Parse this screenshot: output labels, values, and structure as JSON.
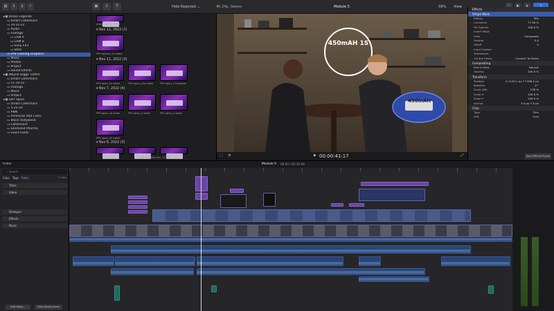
{
  "toolbar": {
    "hide_rejected": "Hide Rejected",
    "format": "4K 24p, Stereo",
    "project": "Module 5",
    "zoom": "59%",
    "view": "View",
    "inspector_title": "Effects",
    "tab_clip": "Clip"
  },
  "library": {
    "items": [
      {
        "label": "Drone Legends",
        "indent": 1
      },
      {
        "label": "Smart Collections",
        "indent": 2
      },
      {
        "label": "10-31-22",
        "indent": 2
      },
      {
        "label": "Audio",
        "indent": 2
      },
      {
        "label": "Footage",
        "indent": 2
      },
      {
        "label": "CAM A",
        "indent": 3
      },
      {
        "label": "CAM B",
        "indent": 3
      },
      {
        "label": "Sony FX3",
        "indent": 3
      },
      {
        "label": "Stills",
        "indent": 3
      },
      {
        "label": "FPV Gaming Graphics",
        "indent": 2,
        "selected": true
      },
      {
        "label": "Music",
        "indent": 2
      },
      {
        "label": "Photos",
        "indent": 2
      },
      {
        "label": "Project",
        "indent": 2
      },
      {
        "label": "Sound Effects",
        "indent": 2
      },
      {
        "label": "Wayne Diggs' Father",
        "indent": 1
      },
      {
        "label": "Smart Collections",
        "indent": 2
      },
      {
        "label": "11-10-22",
        "indent": 2
      },
      {
        "label": "Footage",
        "indent": 2
      },
      {
        "label": "Music",
        "indent": 2
      },
      {
        "label": "Project",
        "indent": 2
      },
      {
        "label": "Self Tapes",
        "indent": 1
      },
      {
        "label": "Smart Collections",
        "indent": 2
      },
      {
        "label": "5-25-20",
        "indent": 2
      },
      {
        "label": "ANN",
        "indent": 2
      },
      {
        "label": "American Red Cross",
        "indent": 2
      },
      {
        "label": "Black Hollywood",
        "indent": 2
      },
      {
        "label": "Catamount",
        "indent": 2
      },
      {
        "label": "Desmond Pharma",
        "indent": 2
      },
      {
        "label": "Giant Foods",
        "indent": 2
      }
    ]
  },
  "browser": {
    "groups": [
      {
        "date": "Nov 12, 2022",
        "count": "(1)",
        "thumbs": [
          "FPV opener_v3 video"
        ]
      },
      {
        "date": "Nov 11, 2022",
        "count": "(3)",
        "thumbs": [
          "FPV open_1a video",
          "FPV open_v2a video",
          "FPV open_1 thoughts"
        ]
      },
      {
        "date": "Nov 7, 2022",
        "count": "(4)",
        "thumbs": [
          "FPV open_1b video",
          "FPV open_2 video",
          "FPV open_2 video"
        ]
      },
      {
        "date": "Nov 6, 2022",
        "count": "(3)",
        "thumbs": [
          "FPV open_v1 video"
        ]
      }
    ],
    "top_label": "unboxing_a6 dl.avi",
    "status": "1 of 13 selected, 10:00"
  },
  "viewer": {
    "overlay_text": "450mAH 1S",
    "battery_text": "450mAH",
    "timecode": "00:00:41:17"
  },
  "inspector": {
    "effect_name": "Shape Mask",
    "rows": [
      {
        "label": "Radius",
        "value": "384"
      },
      {
        "label": "Curvature",
        "value": "77.96 %"
      },
      {
        "label": "Fill Opacity",
        "value": "100.0 %"
      },
      {
        "label": "Invert Mask",
        "value": ""
      },
      {
        "label": "View",
        "value": "Composite"
      },
      {
        "label": "Feather",
        "value": "-3.0"
      },
      {
        "label": "Falloff",
        "value": "0"
      },
      {
        "label": "Input Feather",
        "value": ""
      },
      {
        "label": "Transforms",
        "value": ""
      },
      {
        "label": "Control Points",
        "value": "Convert To Points"
      }
    ],
    "compositing": "Compositing",
    "comp_rows": [
      {
        "label": "Blend Mode",
        "value": "Normal"
      },
      {
        "label": "Opacity",
        "value": "100.0 %"
      }
    ],
    "transform": "Transform",
    "trans_rows": [
      {
        "label": "Position",
        "value": "X 1120.1 px   Y 1398.2 px"
      },
      {
        "label": "Rotation",
        "value": "0 °"
      },
      {
        "label": "Scale (All)",
        "value": "136 %"
      },
      {
        "label": "Scale X",
        "value": "100.0 %"
      },
      {
        "label": "Scale Y",
        "value": "100.0 %"
      },
      {
        "label": "Anchor",
        "value": "X 0 px   Y 0 px"
      }
    ],
    "crop": "Crop",
    "crop_rows": [
      {
        "label": "Type",
        "value": "Trim"
      },
      {
        "label": "Left",
        "value": "0 px"
      }
    ],
    "save_preset": "Save Effects Preset"
  },
  "timeline_header": {
    "index": "Index",
    "project": "Module 5",
    "duration": "00:00 / 02:32:08"
  },
  "index": {
    "search": "Search",
    "tabs": [
      "Clips",
      "Tags",
      "Roles"
    ],
    "count": "5 roles",
    "roles": [
      "Titles",
      "Video",
      "Dialogue",
      "Effects",
      "Music"
    ]
  },
  "bottom": {
    "edit_roles": "Edit Roles...",
    "hide_lanes": "Hide Audio Lanes"
  }
}
